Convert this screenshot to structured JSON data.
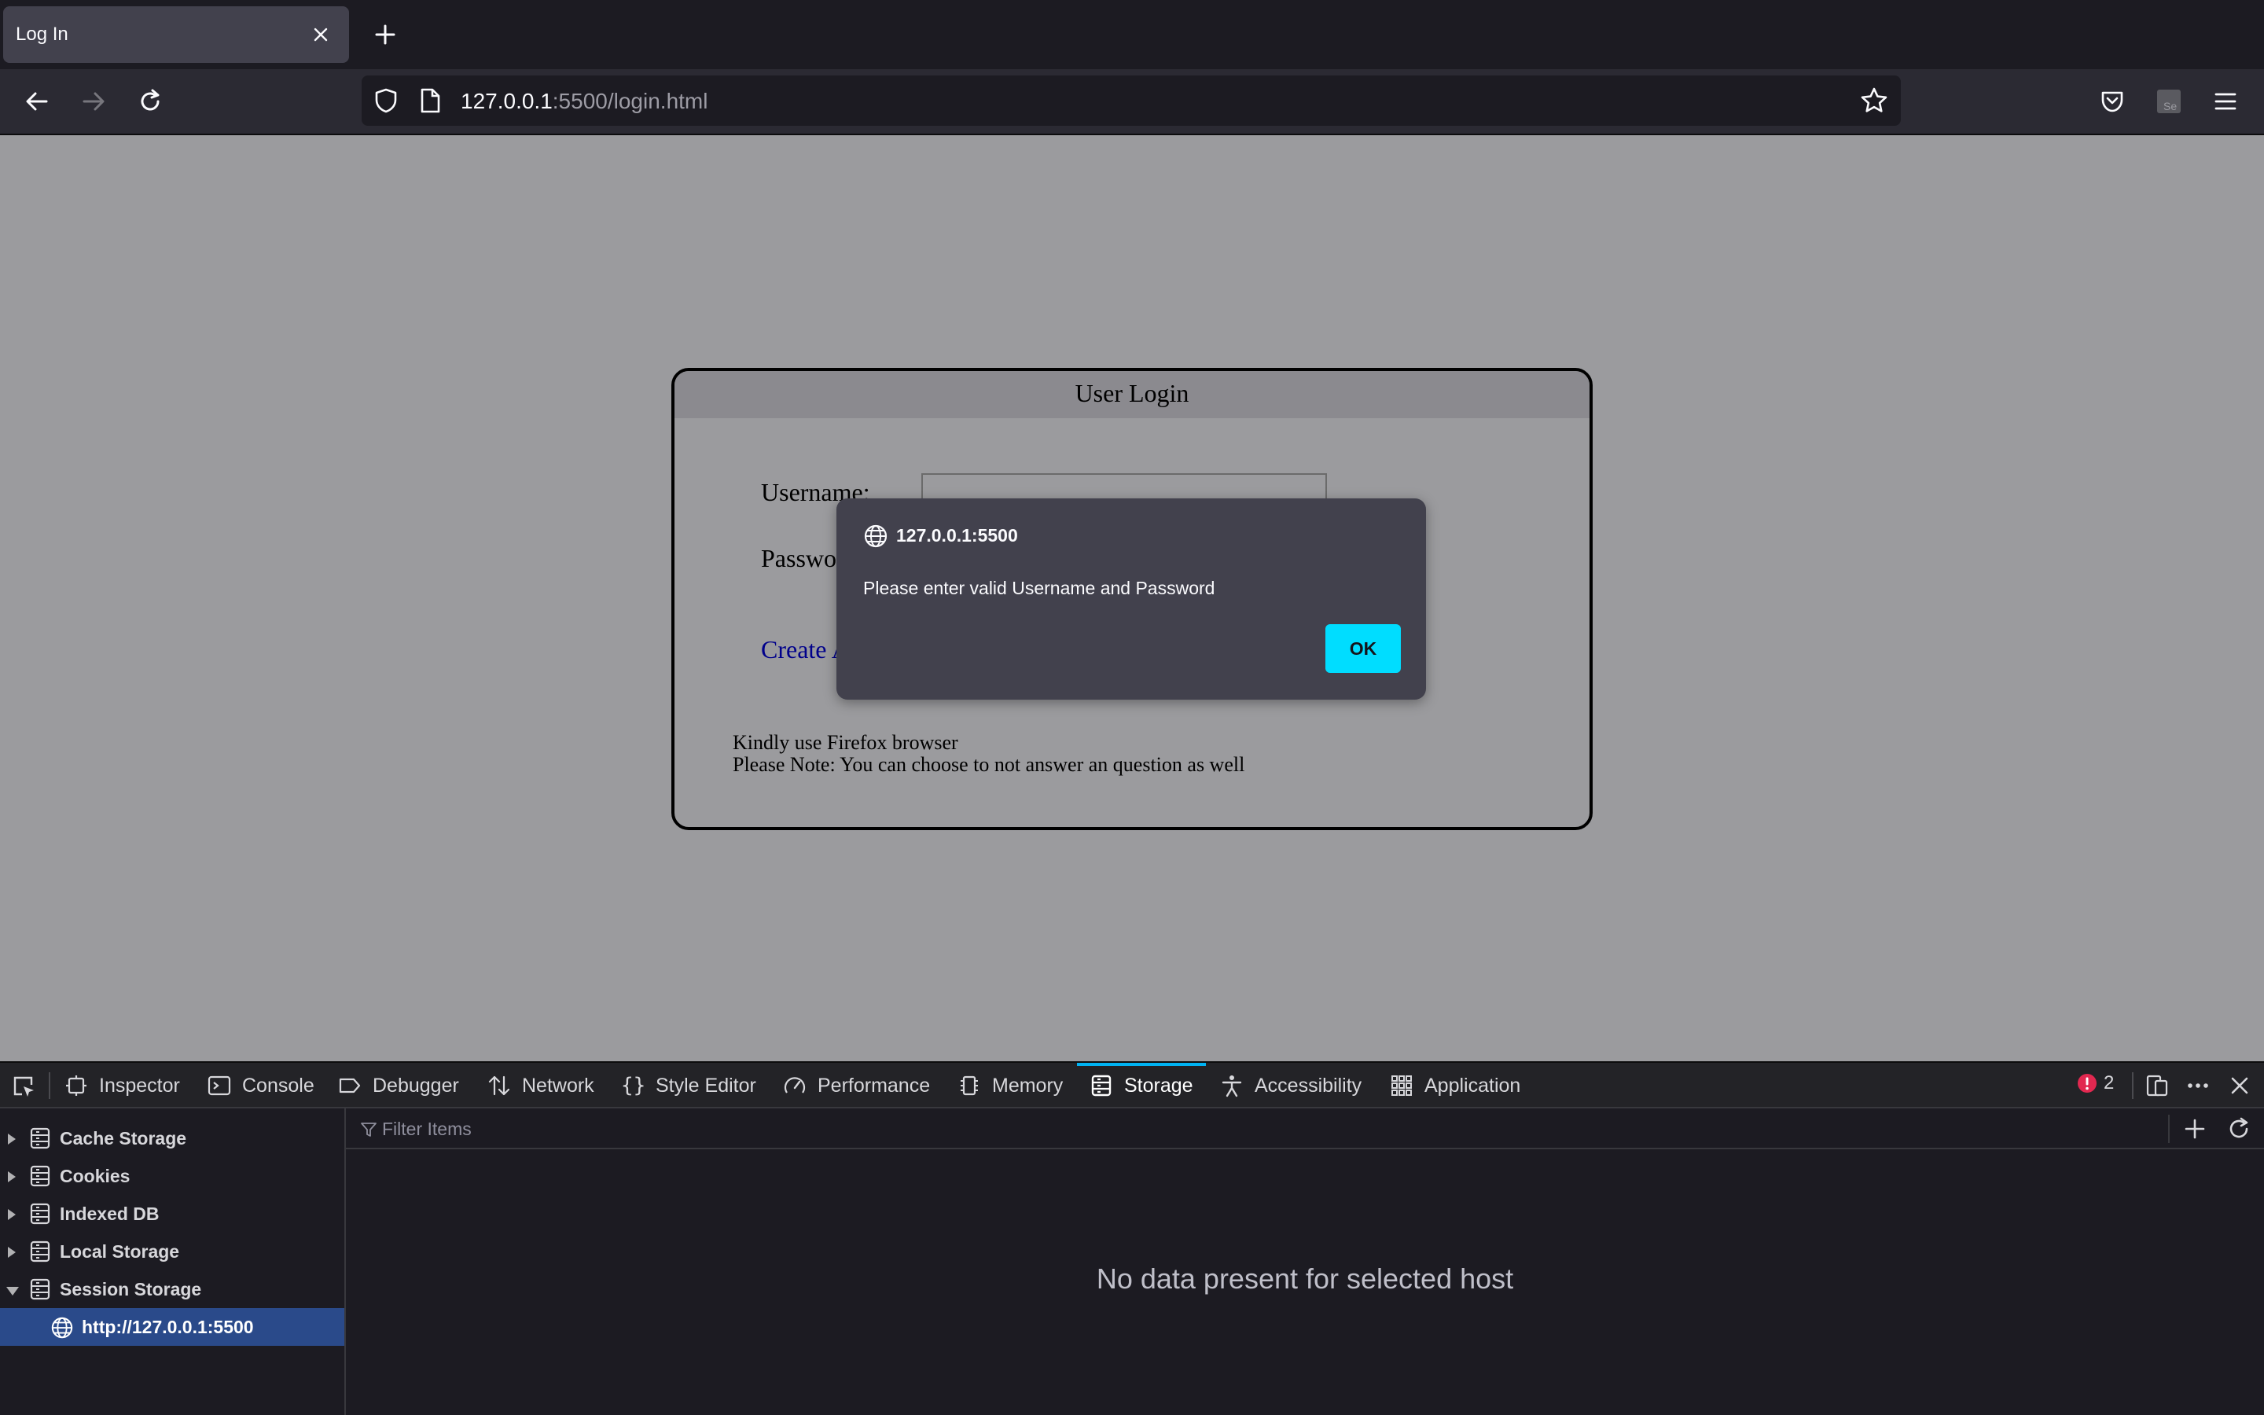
{
  "browser": {
    "tab_title": "Log In",
    "url_host": "127.0.0.1",
    "url_rest": ":5500/login.html"
  },
  "page": {
    "login_title": "User Login",
    "username_label": "Username:",
    "password_label": "Passwo",
    "create_link": "Create A",
    "note_line1": "Kindly use Firefox browser",
    "note_line2": "Please Note: You can choose to not answer an question as well"
  },
  "dialog": {
    "host": "127.0.0.1:5500",
    "message": "Please enter valid Username and Password",
    "ok_label": "OK"
  },
  "devtools": {
    "tabs": [
      {
        "label": "Inspector",
        "icon": "inspector-icon"
      },
      {
        "label": "Console",
        "icon": "console-icon"
      },
      {
        "label": "Debugger",
        "icon": "debugger-icon"
      },
      {
        "label": "Network",
        "icon": "network-icon"
      },
      {
        "label": "Style Editor",
        "icon": "style-editor-icon"
      },
      {
        "label": "Performance",
        "icon": "performance-icon"
      },
      {
        "label": "Memory",
        "icon": "memory-icon"
      },
      {
        "label": "Storage",
        "icon": "storage-icon",
        "active": true
      },
      {
        "label": "Accessibility",
        "icon": "accessibility-icon"
      },
      {
        "label": "Application",
        "icon": "application-icon"
      }
    ],
    "error_count": "2",
    "filter_placeholder": "Filter Items",
    "sidebar": [
      {
        "label": "Cache Storage",
        "expanded": false
      },
      {
        "label": "Cookies",
        "expanded": false
      },
      {
        "label": "Indexed DB",
        "expanded": false
      },
      {
        "label": "Local Storage",
        "expanded": false
      },
      {
        "label": "Session Storage",
        "expanded": true
      },
      {
        "label": "http://127.0.0.1:5500",
        "selected": true
      }
    ],
    "empty_message": "No data present for selected host"
  },
  "colors": {
    "accent": "#00b3f4",
    "ok_button": "#00ddff",
    "selected_row": "#2a4a8a",
    "error": "#e22850"
  }
}
